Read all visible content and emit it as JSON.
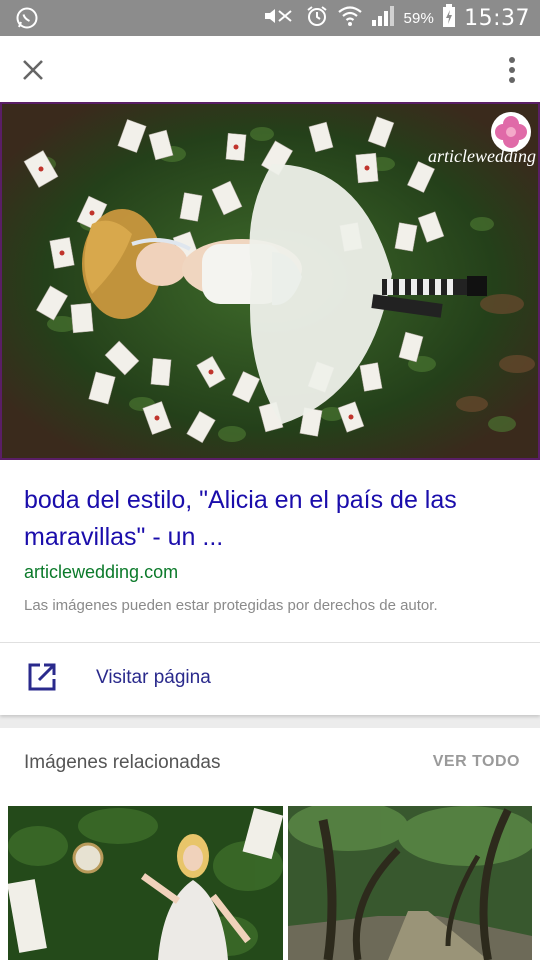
{
  "status_bar": {
    "battery_percent": "59%",
    "time": "15:37",
    "icons": [
      "whatsapp-icon",
      "mute-icon",
      "alarm-icon",
      "wifi-icon",
      "signal-icon",
      "battery-charging-icon"
    ]
  },
  "app_bar": {
    "close_icon": "close-icon",
    "more_icon": "more-vert-icon"
  },
  "hero": {
    "watermark": "articlewedding"
  },
  "result": {
    "title": "boda del estilo, \"Alicia en el país de las maravillas\" - un ...",
    "domain": "articlewedding.com",
    "disclaimer": "Las imágenes pueden estar protegidas por derechos de autor.",
    "visit_label": "Visitar página",
    "visit_icon": "open-in-new-icon"
  },
  "related": {
    "heading": "Imágenes relacionadas",
    "see_all": "VER TODO"
  },
  "colors": {
    "link": "#1a0dab",
    "domain": "#0b7a2a",
    "status_bar": "#8c8c8c"
  }
}
